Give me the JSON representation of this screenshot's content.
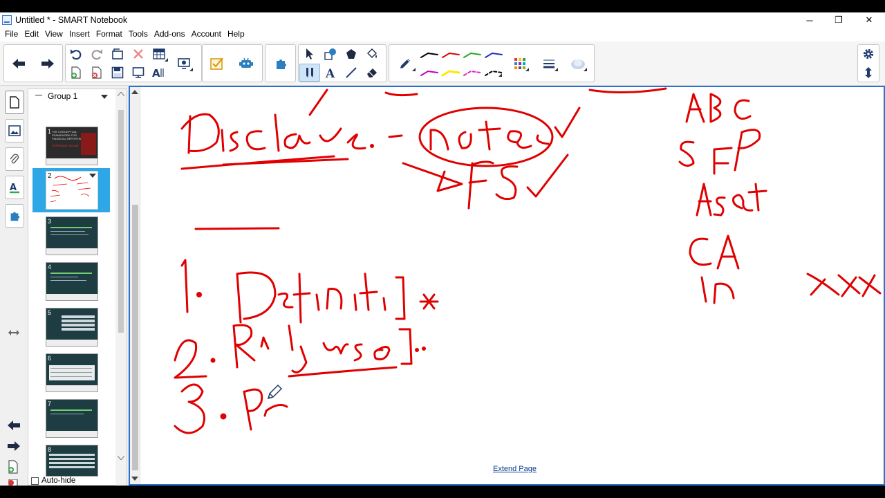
{
  "window": {
    "title": "Untitled * - SMART Notebook",
    "minimize": "─",
    "maximize": "❐",
    "close": "✕"
  },
  "menu": [
    "File",
    "Edit",
    "View",
    "Insert",
    "Format",
    "Tools",
    "Add-ons",
    "Account",
    "Help"
  ],
  "toolbar": {
    "icons": [
      "back-arrow",
      "forward-arrow",
      "undo",
      "redo",
      "screen-shade",
      "delete",
      "table",
      "add-page",
      "save",
      "full-screen",
      "text-recognize",
      "document-camera",
      "response",
      "activity-builder",
      "add-ons",
      "select",
      "shapes",
      "fill",
      "pen",
      "pen-type",
      "text",
      "lines",
      "eraser",
      "settings",
      "move-toolbar"
    ],
    "pen_colors": [
      "#000000",
      "#e00000",
      "#22a822",
      "#1e2fb8",
      "#c000c0",
      "#ffe800",
      "#e020d0",
      "#000000"
    ]
  },
  "sidebar": {
    "tabs": [
      "page-sorter",
      "gallery",
      "attachments",
      "properties",
      "add-ons"
    ],
    "group_label": "Group 1",
    "pages": [
      {
        "number": "1",
        "label": "THE CONCEPTUAL FRAMEWORK FOR FINANCIAL REPORTING",
        "sub": "TOPGRADE ONLINE"
      },
      {
        "number": "2",
        "label": "",
        "sub": ""
      },
      {
        "number": "3",
        "label": "",
        "sub": ""
      },
      {
        "number": "4",
        "label": "",
        "sub": ""
      },
      {
        "number": "5",
        "label": "",
        "sub": ""
      },
      {
        "number": "6",
        "label": "",
        "sub": ""
      },
      {
        "number": "7",
        "label": "",
        "sub": ""
      },
      {
        "number": "8",
        "label": "",
        "sub": ""
      }
    ],
    "selected_page": "2",
    "autohide_label": "Auto-hide",
    "autohide_checked": false
  },
  "canvas": {
    "extend_page": "Extend Page",
    "ink_color": "#e00000"
  }
}
